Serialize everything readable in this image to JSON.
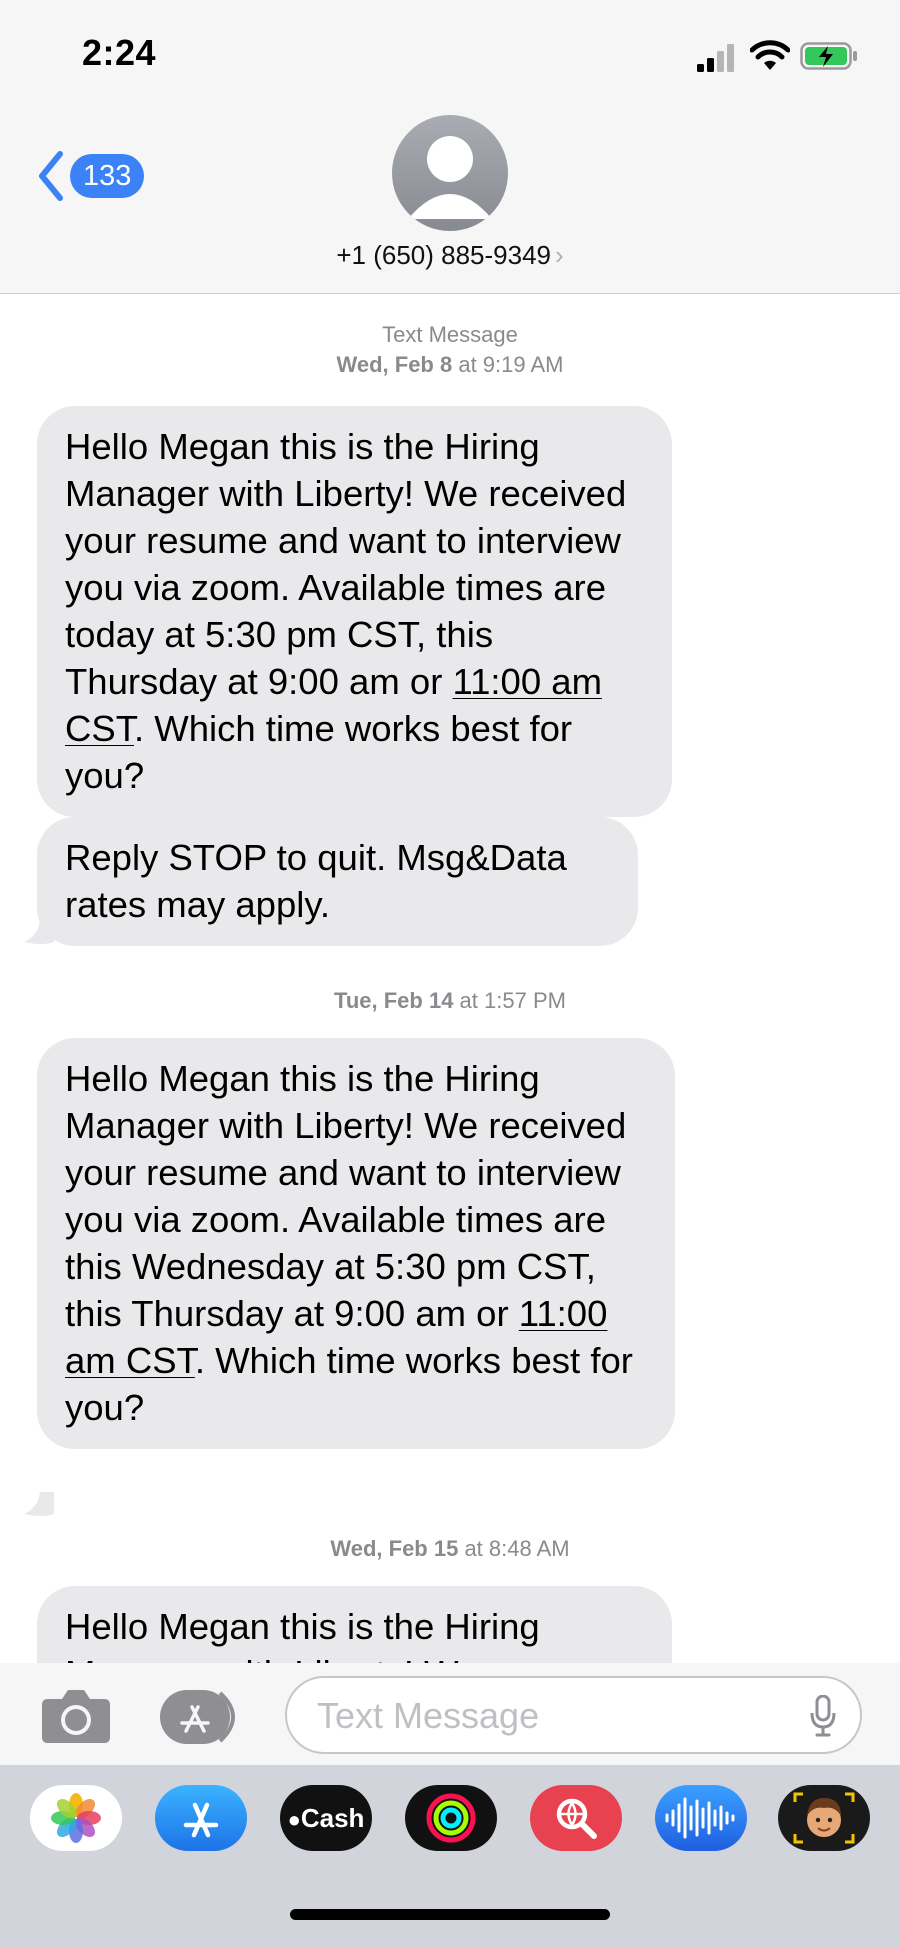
{
  "status_bar": {
    "time": "2:24"
  },
  "header": {
    "back_count": "133",
    "contact": "+1 (650) 885-9349"
  },
  "messages": {
    "service_label": "Text Message",
    "groups": [
      {
        "day": "Wed, Feb 8",
        "time": " at 9:19 AM"
      },
      {
        "day": "Tue, Feb 14",
        "time": " at 1:57 PM"
      },
      {
        "day": "Wed, Feb 15",
        "time": " at 8:48 AM"
      }
    ],
    "m1": {
      "a": "Hello Megan this is the Hiring Manager with Liberty! We received your resume and want to interview you via zoom. Available times are today at 5:30 pm CST, this Thursday at 9:00 am or ",
      "link": "11:00 am CST",
      "b": ". Which time works best for you?"
    },
    "m2": "Reply STOP to quit. Msg&Data rates may apply.",
    "m3": {
      "a": "Hello Megan this is the Hiring Manager with Liberty! We received your resume and want to interview you via zoom. Available times are this Wednesday at 5:30 pm CST, this Thursday at 9:00 am or ",
      "link": "11:00 am CST",
      "b": ". Which time works best for you?"
    },
    "m4": "Hello Megan this is the Hiring Manager with Liberty! We"
  },
  "input": {
    "placeholder": "Text Message"
  },
  "app_drawer": {
    "apps": [
      "photos-icon",
      "app-store-icon",
      "cash-icon",
      "fitness-icon",
      "search-images-icon",
      "audio-message-icon",
      "memoji-icon"
    ],
    "cash_label": "Cash"
  },
  "colors": {
    "accent": "#3a82f6",
    "bubble": "#e9e9eb",
    "timestamp": "#8a8a8e"
  }
}
